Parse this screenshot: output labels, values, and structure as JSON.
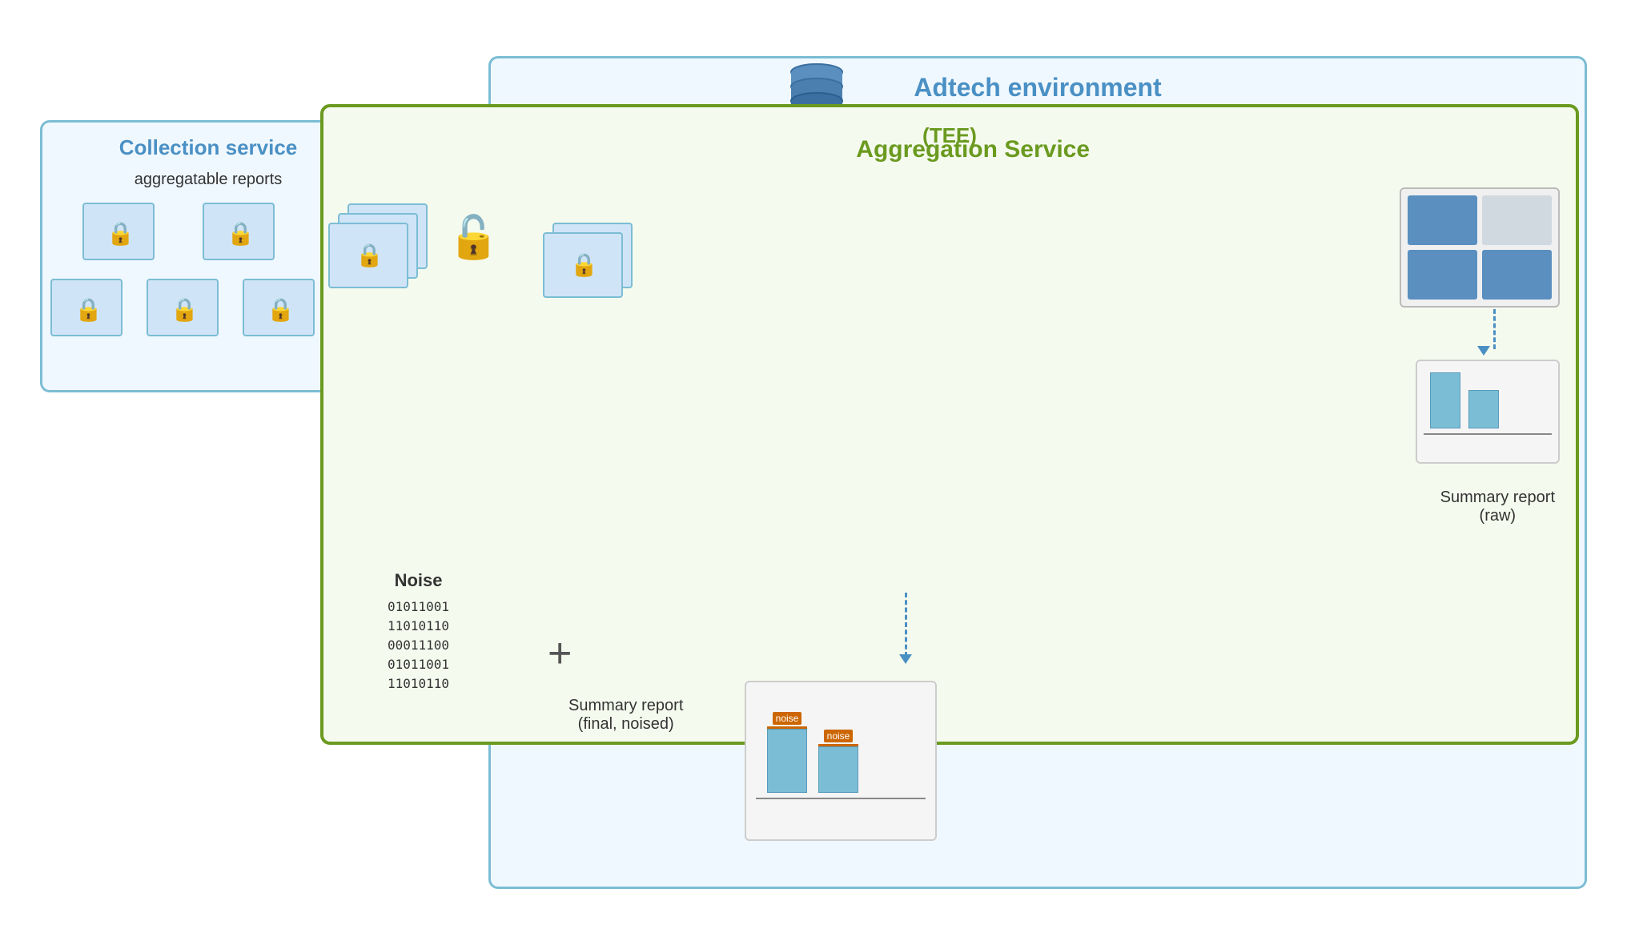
{
  "diagram": {
    "adtech_title": "Adtech environment",
    "collection_title": "Collection service",
    "collection_subtitle": "aggregatable reports",
    "aggregation_title": "Aggregation Service",
    "aggregation_subtitle": "(TEE)",
    "noise_label": "Noise",
    "noise_binary": [
      "01011001",
      "11010110",
      "00011100",
      "01011001",
      "11010110"
    ],
    "summary_raw_label": "Summary report",
    "summary_raw_paren": "(raw)",
    "summary_final_label": "Summary report",
    "summary_final_paren": "(final, noised)",
    "noise_tag1": "noise",
    "noise_tag2": "noise"
  }
}
